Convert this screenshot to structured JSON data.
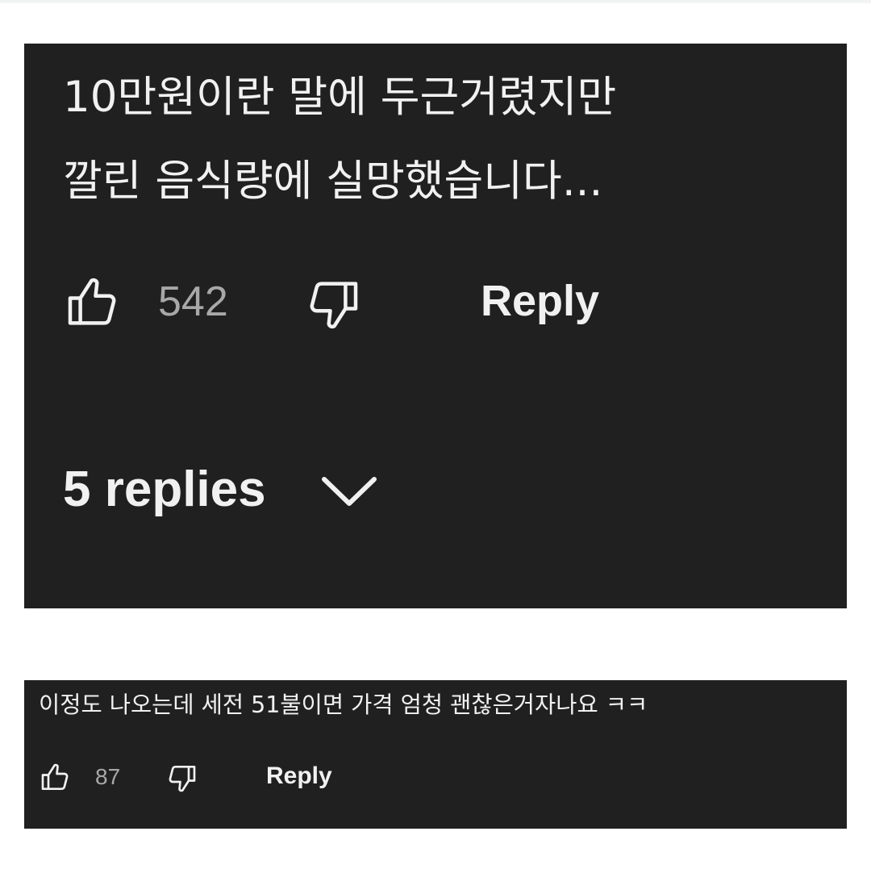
{
  "colors": {
    "card_background": "#202020",
    "page_background": "#ffffff",
    "text_primary": "#f1f1f1",
    "text_secondary": "#a8a8a8"
  },
  "comments": [
    {
      "text_lines": [
        "10만원이란 말에 두근거렸지만",
        "깔린 음식량에 실망했습니다..."
      ],
      "like_icon": "thumbs-up-outline-icon",
      "like_count": "542",
      "dislike_icon": "thumbs-down-outline-icon",
      "reply_label": "Reply",
      "replies_label": "5 replies",
      "replies_icon": "chevron-down-icon"
    },
    {
      "text_lines": [
        "이정도 나오는데 세전 51불이면 가격 엄청 괜찮은거자나요 ㅋㅋ"
      ],
      "like_icon": "thumbs-up-outline-icon",
      "like_count": "87",
      "dislike_icon": "thumbs-down-outline-icon",
      "reply_label": "Reply"
    }
  ]
}
